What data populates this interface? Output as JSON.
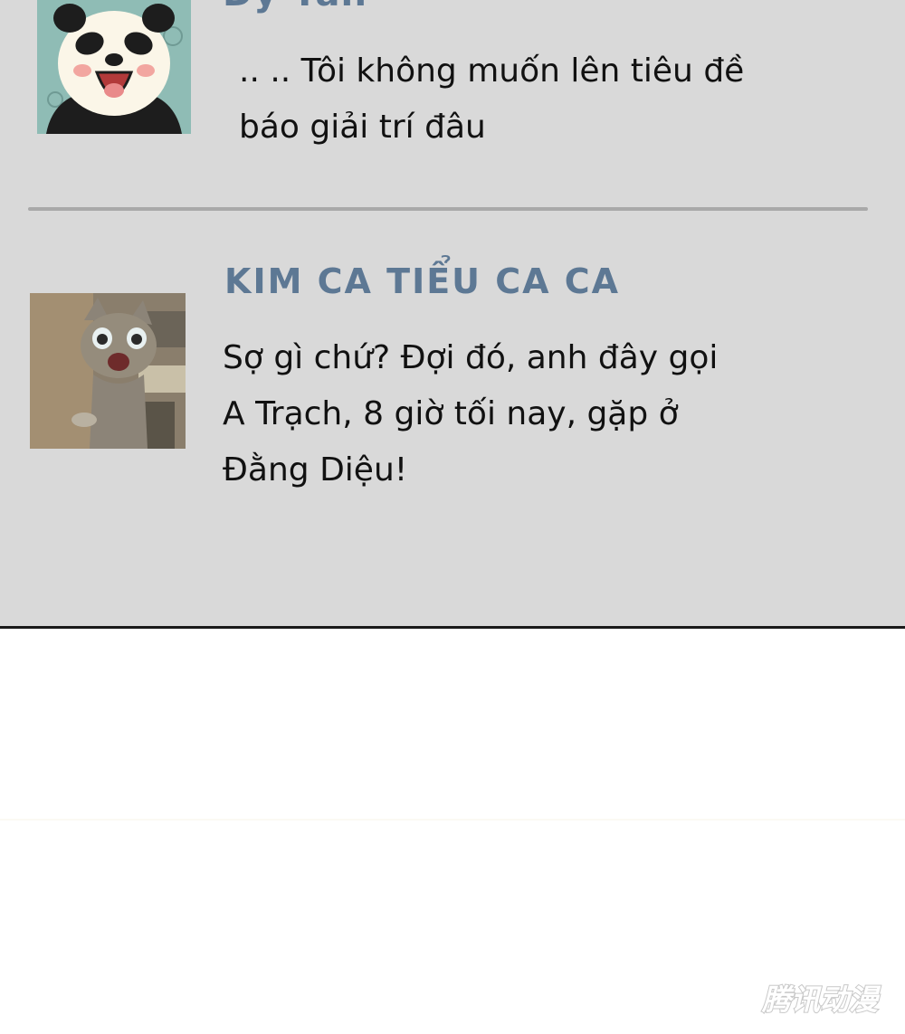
{
  "comments": [
    {
      "name": "Dy Yan",
      "avatar_icon": "panda-avatar-icon",
      "message_lines": [
        ".. .. Tôi không muốn lên tiêu đề",
        "báo giải trí đâu"
      ]
    },
    {
      "name": "KIM CA TIỂU CA CA",
      "avatar_icon": "cat-avatar-icon",
      "message_lines": [
        "Sợ gì chứ? Đợi đó, anh đây gọi",
        "A Trạch, 8 giờ tối nay, gặp ở",
        "Đằng Diệu!"
      ]
    }
  ],
  "watermark": {
    "text": "腾讯动漫",
    "icon": "tencent-comic-logo"
  },
  "colors": {
    "panel_bg": "#d9d9d9",
    "name_color": "#5d7894",
    "text_color": "#111111",
    "divider": "#a9a9a9"
  }
}
